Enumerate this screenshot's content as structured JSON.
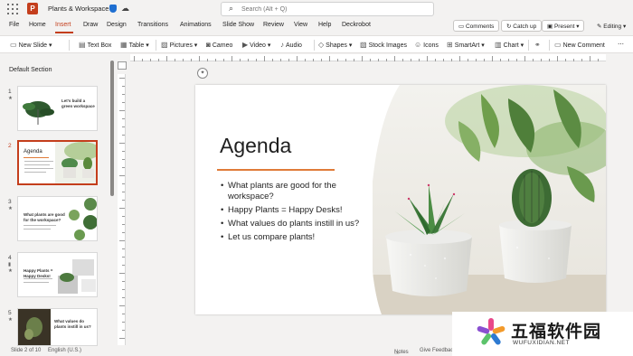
{
  "app": {
    "logo_letter": "P",
    "doc_title": "Plants & Workspace",
    "search_placeholder": "Search (Alt + Q)"
  },
  "menu": {
    "tabs": [
      "File",
      "Home",
      "Insert",
      "Draw",
      "Design",
      "Transitions",
      "Animations",
      "Slide Show",
      "Review",
      "View",
      "Help",
      "Deckrobot"
    ],
    "active": "Insert",
    "comments": "Comments",
    "catch_up": "Catch up",
    "present": "Present",
    "editing": "Editing"
  },
  "ribbon": {
    "new_slide": "New Slide",
    "text_box": "Text Box",
    "table": "Table",
    "pictures": "Pictures",
    "cameo": "Cameo",
    "video": "Video",
    "audio": "Audio",
    "shapes": "Shapes",
    "stock_images": "Stock Images",
    "icons": "Icons",
    "smartart": "SmartArt",
    "chart": "Chart",
    "new_comment": "New Comment"
  },
  "thumbnails": {
    "section_label": "Default Section",
    "numbers": [
      "1",
      "2",
      "3",
      "4",
      "5"
    ],
    "slide1_title": "Let's build a green workspace",
    "slide2_title": "Agenda",
    "slide3_title": "What plants are good for the workspace?",
    "slide4_title": "Happy Plants = Happy Desks!",
    "slide5_title": "What values do plants instill in us?"
  },
  "slide": {
    "title": "Agenda",
    "bullets": [
      "What plants are good for the workspace?",
      "Happy Plants = Happy Desks!",
      "What values do plants instill in us?",
      "Let us compare plants!"
    ]
  },
  "status": {
    "slide_of": "Slide 2 of 10",
    "language": "English (U.S.)",
    "notes": "Notes",
    "feedback": "Give Feedback"
  },
  "watermark": {
    "text": "五福软件园",
    "url": "WUFUXIDIAN.NET"
  },
  "colors": {
    "accent": "#c43e1c",
    "title_underline": "#e07b39"
  }
}
